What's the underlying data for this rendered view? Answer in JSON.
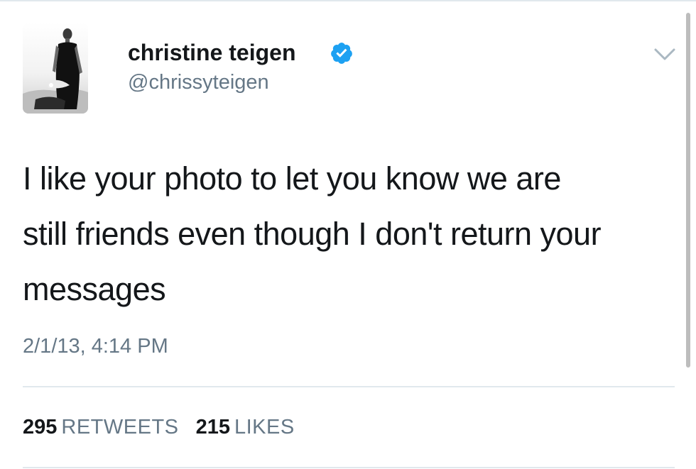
{
  "author": {
    "display_name": "christine teigen",
    "handle": "@chrissyteigen",
    "verified": true,
    "avatar_icon": "profile-photo",
    "verified_icon": "verified-badge-icon"
  },
  "tweet": {
    "lines": [
      "I like your photo to let you know we are",
      "still friends even though I don't return your",
      "messages"
    ],
    "timestamp": "2/1/13, 4:14 PM"
  },
  "stats": {
    "retweets_count": "295",
    "retweets_label": "RETWEETS",
    "likes_count": "215",
    "likes_label": "LIKES"
  },
  "colors": {
    "text": "#14171a",
    "secondary": "#657786",
    "verified": "#1da1f2",
    "divider": "#e1e8ed"
  }
}
